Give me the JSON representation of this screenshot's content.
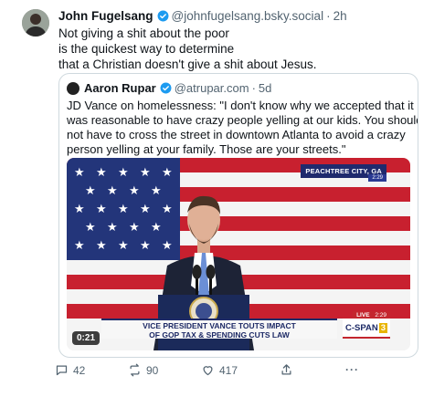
{
  "post": {
    "author_name": "John Fugelsang",
    "author_handle": "@johnfugelsang.bsky.social",
    "separator": "·",
    "time": "2h",
    "text_lines": [
      "Not giving a shit about the poor",
      "is the quickest way to determine",
      "that a Christian doesn't give a shit about Jesus."
    ],
    "verified_color": "#1d9bf0"
  },
  "quote": {
    "author_name": "Aaron Rupar",
    "author_handle": "@atrupar.com",
    "separator": "·",
    "time": "5d",
    "text_lines": [
      "JD Vance on homelessness: \"I don't know why we accepted that it",
      "was reasonable to have crazy people yelling at our kids. You should",
      "not have to cross the street in downtown Atlanta to avoid a crazy",
      "person yelling at your family. Those are your streets.\""
    ],
    "video": {
      "location_banner": "PEACHTREE CITY, GA",
      "location_time": "2:29",
      "live_label": "LIVE",
      "live_time": "2:29",
      "headline_line1": "VICE PRESIDENT VANCE TOUTS IMPACT",
      "headline_line2": "OF GOP TAX & SPENDING CUTS LAW",
      "network": "C-SPAN",
      "network_number": "3",
      "duration": "0:21"
    }
  },
  "actions": {
    "reply_count": "42",
    "repost_count": "90",
    "like_count": "417",
    "share_icon": "share-icon",
    "more_label": "···"
  }
}
